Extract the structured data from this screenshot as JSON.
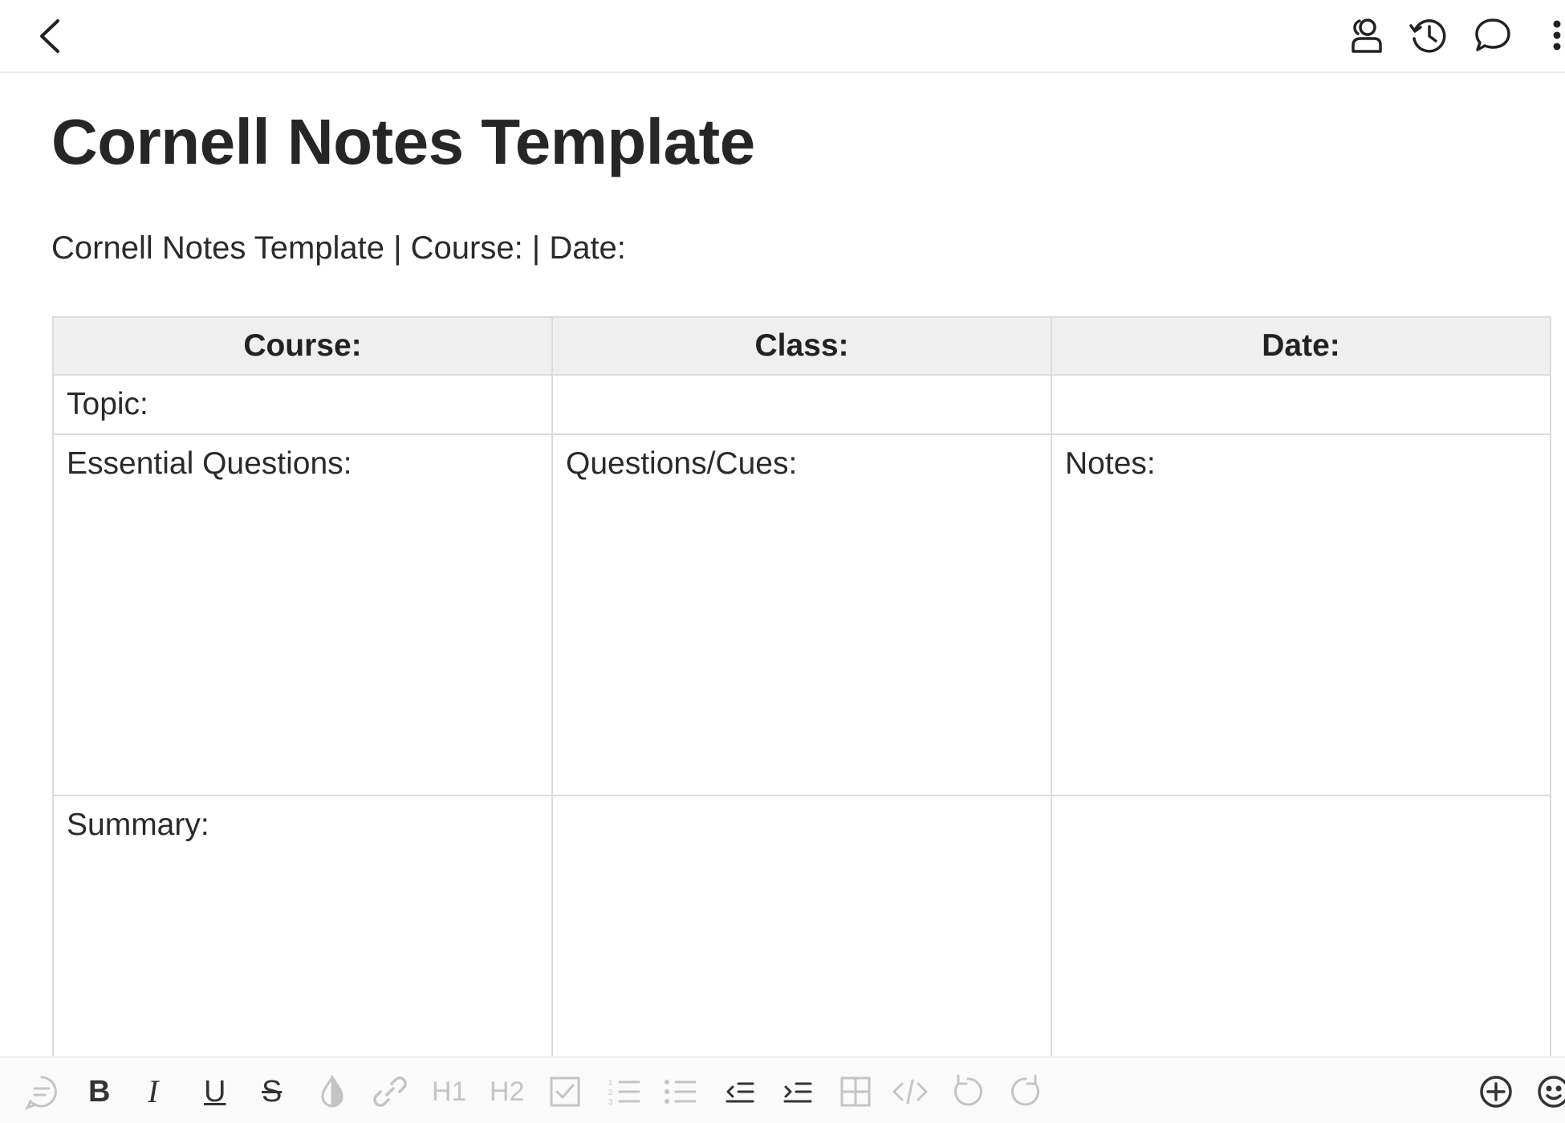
{
  "doc": {
    "title": "Cornell Notes Template",
    "subtitle": "Cornell Notes Template | Course: | Date:"
  },
  "table": {
    "headers": [
      "Course:",
      "Class:",
      "Date:"
    ],
    "rows": [
      [
        "Topic:",
        "",
        ""
      ],
      [
        "Essential Questions:",
        "Questions/Cues:",
        "Notes:"
      ],
      [
        "Summary:",
        "",
        ""
      ]
    ]
  },
  "toolbar": {
    "bold_label": "B",
    "italic_label": "I",
    "underline_label": "U",
    "strike_label": "S",
    "h1_label": "H1",
    "h2_label": "H2"
  },
  "icons": {
    "top": [
      "back-icon",
      "collaborators-icon",
      "history-icon",
      "comment-icon",
      "more-vertical-icon"
    ],
    "bottom": [
      "comment-format-icon",
      "color-icon",
      "link-icon",
      "checkbox-icon",
      "numbered-list-icon",
      "bullet-list-icon",
      "outdent-icon",
      "indent-icon",
      "table-icon",
      "code-icon",
      "undo-icon",
      "redo-icon",
      "add-icon",
      "emoji-icon"
    ]
  },
  "colors": {
    "text": "#262626",
    "header_bg": "#efefef",
    "border": "#dcdcdc",
    "toolbar_active": "#333333",
    "toolbar_disabled": "#c4c4c4"
  }
}
